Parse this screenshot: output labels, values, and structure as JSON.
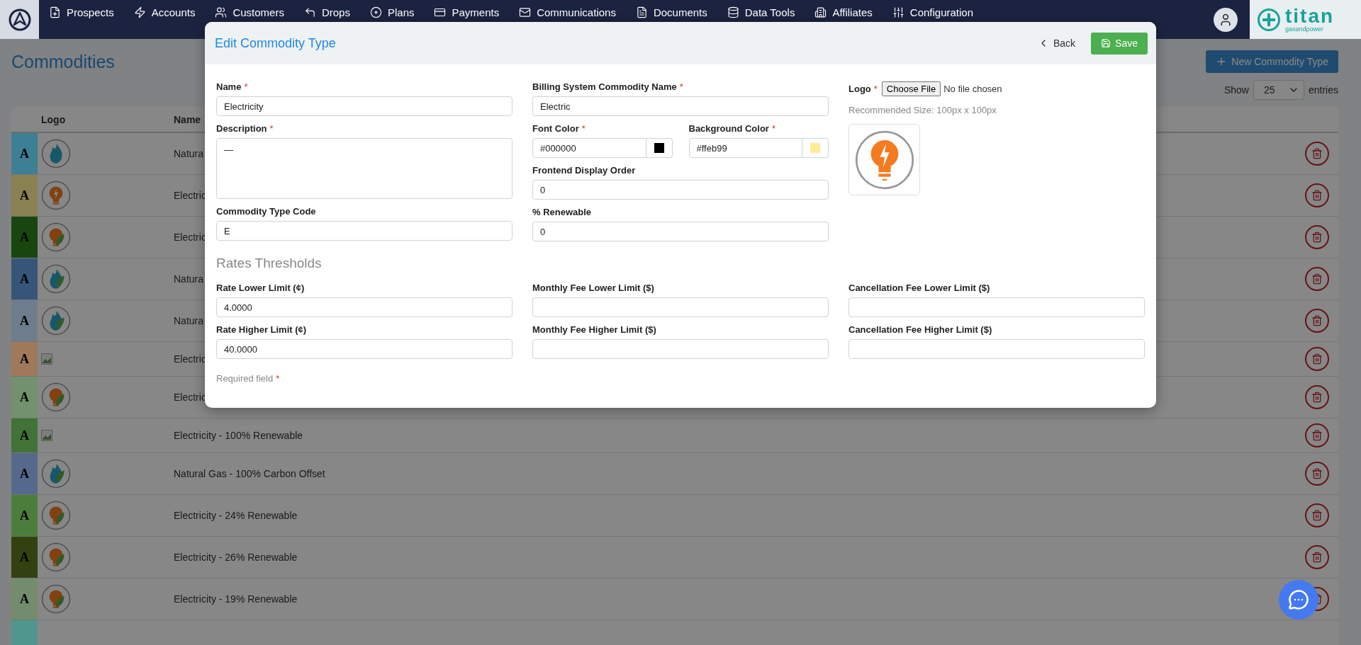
{
  "nav": {
    "items": [
      {
        "label": "Prospects"
      },
      {
        "label": "Accounts"
      },
      {
        "label": "Customers"
      },
      {
        "label": "Drops"
      },
      {
        "label": "Plans"
      },
      {
        "label": "Payments"
      },
      {
        "label": "Communications"
      },
      {
        "label": "Documents"
      },
      {
        "label": "Data Tools"
      },
      {
        "label": "Affiliates"
      },
      {
        "label": "Configuration"
      }
    ],
    "brand": {
      "name": "titan",
      "tagline": "gasandpower"
    }
  },
  "page": {
    "title": "Commodities",
    "new_button": "New Commodity Type",
    "show_label": "Show",
    "page_size": "25",
    "entries_label": "entries"
  },
  "table": {
    "columns": [
      "Logo",
      "Name"
    ],
    "rows": [
      {
        "letter": "A",
        "color": "#3d8095",
        "kind": "gas",
        "name": "Natura"
      },
      {
        "letter": "A",
        "color": "#8a8152",
        "kind": "bulb",
        "name": "Electric"
      },
      {
        "letter": "A",
        "color": "#19460f",
        "kind": "bulb-leaf",
        "name": "Electric"
      },
      {
        "letter": "A",
        "color": "#375578",
        "kind": "gas-leaf",
        "name": "Natura"
      },
      {
        "letter": "A",
        "color": "#6e7d8c",
        "kind": "gas-leaf",
        "name": "Natura"
      },
      {
        "letter": "A",
        "color": "#a0785a",
        "kind": "broken",
        "name": "Electric"
      },
      {
        "letter": "A",
        "color": "#73916e",
        "kind": "bulb-leaf",
        "name": "Electric"
      },
      {
        "letter": "A",
        "color": "#417337",
        "kind": "broken",
        "name": "Electricity - 100% Renewable"
      },
      {
        "letter": "A",
        "color": "#55698c",
        "kind": "gas-leaf",
        "name": "Natural Gas - 100% Carbon Offset"
      },
      {
        "letter": "A",
        "color": "#4b7d3c",
        "kind": "bulb-leaf",
        "name": "Electricity - 24% Renewable"
      },
      {
        "letter": "A",
        "color": "#32410f",
        "kind": "bulb-leaf",
        "name": "Electricity - 26% Renewable"
      },
      {
        "letter": "A",
        "color": "#738c6e",
        "kind": "bulb-leaf",
        "name": "Electricity - 19% Renewable"
      },
      {
        "color": "#50968c",
        "kind": "cut"
      }
    ]
  },
  "modal": {
    "title": "Edit Commodity Type",
    "back_label": "Back",
    "save_label": "Save",
    "name": {
      "label": "Name",
      "required_mark": "*",
      "value": "Electricity"
    },
    "description": {
      "label": "Description",
      "required_mark": "*",
      "value": "—"
    },
    "code": {
      "label": "Commodity Type Code",
      "value": "E"
    },
    "billing_name": {
      "label": "Billing System Commodity Name",
      "required_mark": "*",
      "value": "Electric"
    },
    "font_color": {
      "label": "Font Color",
      "required_mark": "*",
      "value": "#000000"
    },
    "background_color": {
      "label": "Background Color",
      "required_mark": "*",
      "value": "#ffeb99"
    },
    "display_order": {
      "label": "Frontend Display Order",
      "value": "0"
    },
    "renewable": {
      "label": "% Renewable",
      "value": "0"
    },
    "logo": {
      "label": "Logo",
      "required_mark": "*",
      "button": "Choose File",
      "file_status": "No file chosen",
      "hint": "Recommended Size: 100px x 100px"
    },
    "thresholds": {
      "title": "Rates Thresholds",
      "groups": [
        {
          "fields": [
            {
              "label": "Rate Lower Limit (¢)",
              "value": "4.0000"
            },
            {
              "label": "Rate Higher Limit (¢)",
              "value": "40.0000"
            }
          ]
        },
        {
          "fields": [
            {
              "label": "Monthly Fee Lower Limit ($)"
            },
            {
              "label": "Monthly Fee Higher Limit ($)"
            }
          ]
        },
        {
          "fields": [
            {
              "label": "Cancellation Fee Lower Limit ($)"
            },
            {
              "label": "Cancellation Fee Higher Limit ($)"
            }
          ]
        }
      ]
    },
    "footnote": {
      "text": "Required field",
      "required_mark": "*"
    }
  }
}
